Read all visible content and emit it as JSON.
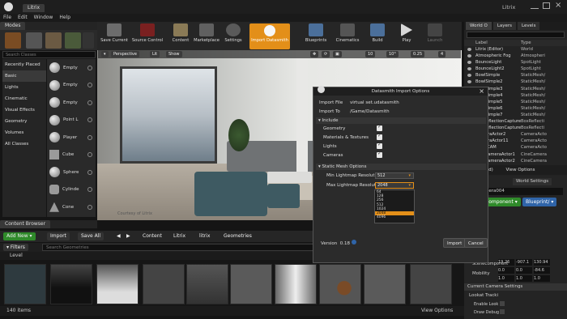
{
  "window": {
    "tab_title": "Litrix",
    "brand": "Litrix"
  },
  "menu": [
    "File",
    "Edit",
    "Window",
    "Help"
  ],
  "modes_tab": "Modes",
  "search_classes_placeholder": "Search Classes",
  "categories": [
    "Recently Placed",
    "Basic",
    "Lights",
    "Cinematic",
    "Visual Effects",
    "Geometry",
    "Volumes",
    "All Classes"
  ],
  "selected_category": "Basic",
  "place_items": [
    "Empty",
    "Empty",
    "Empty",
    "Point L",
    "Player",
    "Cube",
    "Sphere",
    "Cylinde",
    "Cone"
  ],
  "toolbar": [
    "Save Current",
    "Source Control",
    "Content",
    "Marketplace",
    "Settings",
    "Import Datasmith",
    "Blueprints",
    "Cinematics",
    "Build",
    "Play",
    "Launch"
  ],
  "viewport": {
    "perspective": "Perspective",
    "lit": "Lit",
    "show": "Show",
    "snap_values": [
      "10",
      "10°",
      "0.25",
      "4"
    ],
    "watermark": "Courtesy of Litrix"
  },
  "world_outliner": {
    "tabs": [
      "World O",
      "Layers",
      "Levels"
    ],
    "columns": [
      "Label",
      "Type"
    ],
    "rows": [
      {
        "label": "Litrix (Editor)",
        "type": "World"
      },
      {
        "label": "Atmospheric Fog",
        "type": "Atmospheri"
      },
      {
        "label": "BounceLight",
        "type": "SpotLight"
      },
      {
        "label": "BounceLight2",
        "type": "SpotLight"
      },
      {
        "label": "BowlSimple",
        "type": "StaticMesh/"
      },
      {
        "label": "BowlSimple2",
        "type": "StaticMesh/"
      },
      {
        "label": "BowlSimple3",
        "type": "StaticMesh/"
      },
      {
        "label": "BowlSimple4",
        "type": "StaticMesh/"
      },
      {
        "label": "BowlSimple5",
        "type": "StaticMesh/"
      },
      {
        "label": "BowlSimple6",
        "type": "StaticMesh/"
      },
      {
        "label": "BowlSimple7",
        "type": "StaticMesh/"
      },
      {
        "label": "BoxReflectionCapture",
        "type": "BoxReflecti"
      },
      {
        "label": "BoxReflectionCapture",
        "type": "BoxReflecti"
      },
      {
        "label": "CameraActor2",
        "type": "CameraActo"
      },
      {
        "label": "CameraActor11",
        "type": "CameraActo"
      },
      {
        "label": "Cine_CAM",
        "type": "CameraActo"
      },
      {
        "label": "CineCameraActor1",
        "type": "CineCamera"
      },
      {
        "label": "CineCameraActor2",
        "type": "CineCamera"
      }
    ],
    "footer_selected": "(1 selected)",
    "view_options": "View Options"
  },
  "details": {
    "tab": "World Settings",
    "actor": "mera004",
    "add_component": "Component",
    "blueprint": "Blueprint/",
    "xyz": [
      "19.26",
      "-907.1",
      "130.94"
    ],
    "xyz2": [
      "0.0",
      "0.0",
      "-84.6"
    ],
    "scale": [
      "1.0",
      "1.0",
      "1.0"
    ],
    "scene_component": "SceneComponent",
    "mobility": "Mobility",
    "camera_settings": "Current Camera Settings",
    "lookat": "Lookat Tracki",
    "enable_look": "Enable Look",
    "draw_debug": "Draw Debug"
  },
  "content_browser": {
    "tab": "Content Browser",
    "add_new": "Add New",
    "import": "Import",
    "save_all": "Save All",
    "path": [
      "Content",
      "Litrix",
      "litrix",
      "Geometries"
    ],
    "filters": "Filters",
    "search_placeholder": "Search Geometries",
    "level": "Level",
    "items_count": "140 items",
    "view_options": "View Options"
  },
  "dialog": {
    "title": "Datasmith Import Options",
    "import_file_label": "Import File",
    "import_file": "virtual set.udatasmith",
    "import_to_label": "Import To",
    "import_to": "/Game/Datasmith",
    "include": "Include",
    "include_items": [
      "Geometry",
      "Materials & Textures",
      "Lights",
      "Cameras"
    ],
    "static_mesh": "Static Mesh Options",
    "min_lightmap": "Min Lightmap Resolutio",
    "min_value": "512",
    "max_lightmap": "Max Lightmap Resolutio",
    "max_value": "2048",
    "options": [
      "64",
      "128",
      "256",
      "512",
      "1024",
      "2048",
      "4096"
    ],
    "selected_option": "2048",
    "version_label": "Version",
    "version": "0.18",
    "import_btn": "Import",
    "cancel_btn": "Cancel"
  }
}
